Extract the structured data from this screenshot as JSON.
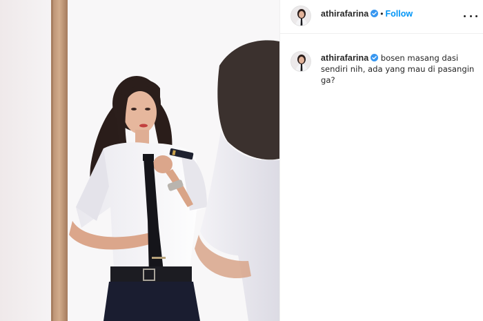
{
  "post": {
    "header": {
      "username": "athirafarina",
      "separator": "•",
      "follow_label": "Follow"
    },
    "caption": {
      "username": "athirafarina",
      "text": "bosen masang dasi sendiri nih, ada yang mau di pasangin ga?"
    },
    "icons": {
      "verified": "verified-badge-icon",
      "more": "more-options-icon"
    },
    "colors": {
      "accent": "#0095f6",
      "verified": "#3897f0",
      "divider": "#efefef"
    }
  }
}
